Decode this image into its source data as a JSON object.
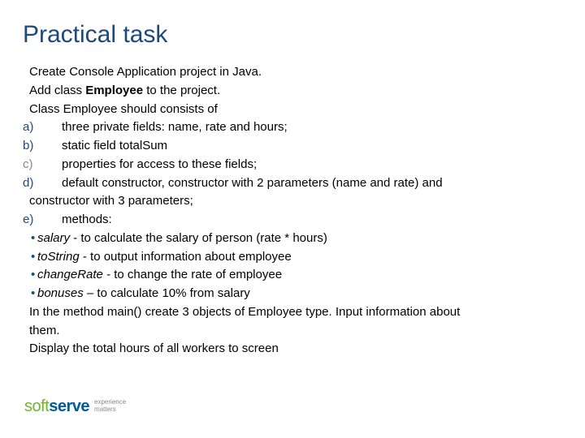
{
  "title": "Practical task",
  "intro": {
    "line1": "Create Console Application project in Java.",
    "line2_pre": "Add class ",
    "line2_strong": "Employee",
    "line2_post": " to the project.",
    "line3": "Class Employee should consists of"
  },
  "items": {
    "a": {
      "marker": "a)",
      "text": "three private fields: name, rate and hours;"
    },
    "b": {
      "marker": "b)",
      "text": "static field totalSum"
    },
    "c": {
      "marker": "c)",
      "text": "properties for access to these fields;"
    },
    "d": {
      "marker": "d)",
      "text": "default constructor, constructor with 2 parameters (name and rate) and constructor with 3 parameters;",
      "text_line1": "default constructor, constructor with 2 parameters (name and rate) and",
      "text_line2": "constructor with 3 parameters;"
    },
    "e": {
      "marker": "e)",
      "text": "methods:"
    }
  },
  "methods": {
    "salary": {
      "name": "salary",
      "desc": " - to calculate the salary of person (rate * hours)"
    },
    "toString": {
      "name": "toString",
      "desc": " - to output information about employee"
    },
    "changeRate": {
      "name": "changeRate",
      "desc": " - to change the rate of employee"
    },
    "bonuses": {
      "name": "bonuses",
      "desc": " – to calculate 10% from salary"
    }
  },
  "conclusion": {
    "line1": "In the method main() create 3 objects of Employee type. Input information about them.",
    "line1a": "In the method main() create 3 objects of Employee type. Input information about",
    "line1b": "them.",
    "line2": "Display the total hours of all workers to screen"
  },
  "logo": {
    "soft": "soft",
    "serve": "serve",
    "tag1": "experience",
    "tag2": "matters"
  }
}
